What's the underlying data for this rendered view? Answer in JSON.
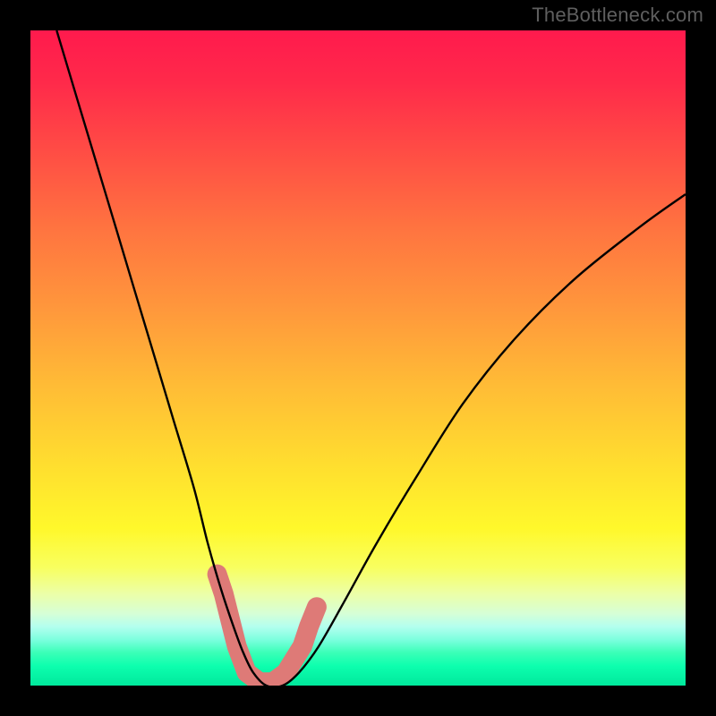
{
  "watermark": "TheBottleneck.com",
  "chart_data": {
    "type": "line",
    "title": "",
    "xlabel": "",
    "ylabel": "",
    "xlim": [
      0,
      100
    ],
    "ylim": [
      0,
      100
    ],
    "series": [
      {
        "name": "bottleneck-curve",
        "x": [
          4,
          7,
          10,
          13,
          16,
          19,
          22,
          25,
          27,
          29,
          31,
          32.5,
          34,
          36,
          38.5,
          41,
          44,
          48,
          53,
          59,
          66,
          74,
          83,
          93,
          100
        ],
        "y": [
          100,
          90,
          80,
          70,
          60,
          50,
          40,
          30,
          22,
          15,
          9,
          5,
          2,
          0,
          0,
          2,
          6,
          13,
          22,
          32,
          43,
          53,
          62,
          70,
          75
        ]
      }
    ],
    "markers": {
      "name": "highlight-dots",
      "points_x": [
        28.5,
        29.5,
        31.5,
        33.0,
        35.0,
        37.0,
        39.0,
        41.5,
        42.5,
        43.7
      ],
      "points_y": [
        17,
        14,
        6,
        2,
        0.5,
        0.5,
        2,
        6,
        9,
        12
      ],
      "color": "#de7a77"
    },
    "background_gradient": {
      "top": "#ff1a4d",
      "mid": "#ffe72d",
      "bottom": "#00e99c"
    }
  }
}
